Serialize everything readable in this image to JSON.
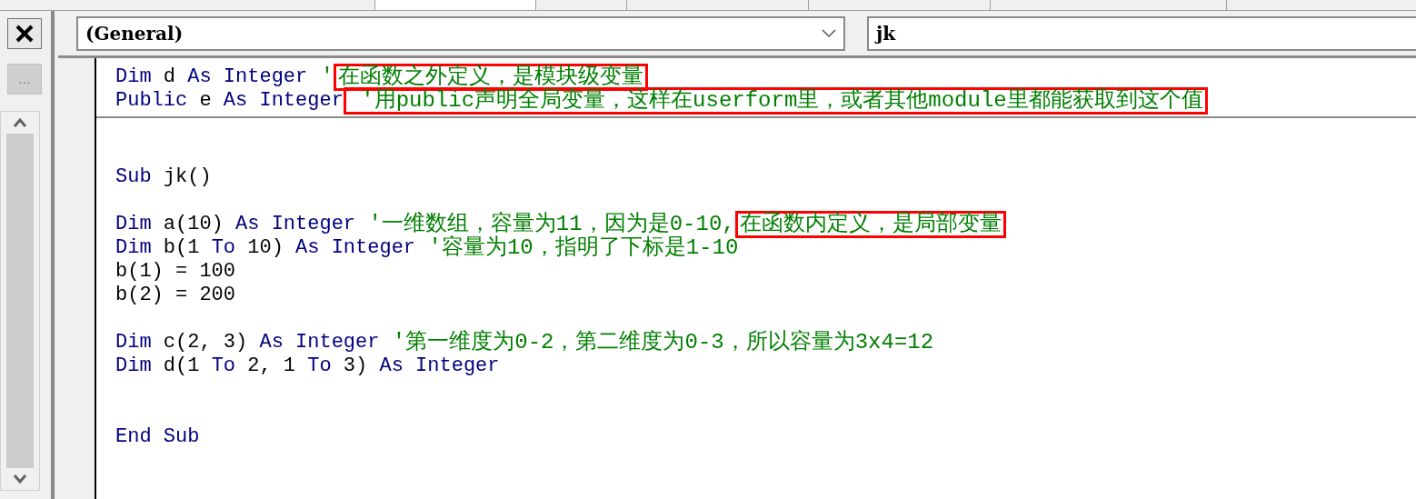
{
  "side_panel": {
    "ellipsis_button": {
      "label": "...",
      "disabled": true
    }
  },
  "object_box": {
    "value": "(General)"
  },
  "procedure_box": {
    "value": "jk"
  },
  "declarations": [
    {
      "kind": "code",
      "tokens": [
        {
          "kind": "keyword",
          "text": "Dim"
        },
        {
          "kind": "plain",
          "text": " d "
        },
        {
          "kind": "keyword",
          "text": "As Integer"
        },
        {
          "kind": "comment",
          "text": " '"
        },
        {
          "kind": "comment",
          "text": "在函数之外定义，是模块级变量",
          "boxed": true
        }
      ]
    },
    {
      "kind": "code",
      "tokens": [
        {
          "kind": "keyword",
          "text": "Public"
        },
        {
          "kind": "plain",
          "text": " e "
        },
        {
          "kind": "keyword",
          "text": "As Integer"
        },
        {
          "kind": "comment",
          "text": " '用public声明全局变量，这样在userform里，或者其他module里都能获取到这个值",
          "boxed": true
        }
      ]
    }
  ],
  "procedure": [
    {
      "kind": "blank"
    },
    {
      "kind": "blank"
    },
    {
      "kind": "code",
      "tokens": [
        {
          "kind": "keyword",
          "text": "Sub"
        },
        {
          "kind": "plain",
          "text": " jk()"
        }
      ]
    },
    {
      "kind": "blank"
    },
    {
      "kind": "code",
      "tokens": [
        {
          "kind": "keyword",
          "text": "Dim"
        },
        {
          "kind": "plain",
          "text": " a(10) "
        },
        {
          "kind": "keyword",
          "text": "As Integer"
        },
        {
          "kind": "comment",
          "text": " '一维数组，容量为11，因为是0-10,"
        },
        {
          "kind": "comment",
          "text": "在函数内定义，是局部变量",
          "boxed": true
        }
      ]
    },
    {
      "kind": "code",
      "tokens": [
        {
          "kind": "keyword",
          "text": "Dim"
        },
        {
          "kind": "plain",
          "text": " b(1 "
        },
        {
          "kind": "keyword",
          "text": "To"
        },
        {
          "kind": "plain",
          "text": " 10) "
        },
        {
          "kind": "keyword",
          "text": "As Integer"
        },
        {
          "kind": "comment",
          "text": " '容量为10，指明了下标是1-10"
        }
      ]
    },
    {
      "kind": "code",
      "tokens": [
        {
          "kind": "plain",
          "text": "b(1) = 100"
        }
      ]
    },
    {
      "kind": "code",
      "tokens": [
        {
          "kind": "plain",
          "text": "b(2) = 200"
        }
      ]
    },
    {
      "kind": "blank"
    },
    {
      "kind": "code",
      "tokens": [
        {
          "kind": "keyword",
          "text": "Dim"
        },
        {
          "kind": "plain",
          "text": " c(2, 3) "
        },
        {
          "kind": "keyword",
          "text": "As Integer"
        },
        {
          "kind": "comment",
          "text": " '第一维度为0-2，第二维度为0-3，所以容量为3x4=12"
        }
      ]
    },
    {
      "kind": "code",
      "tokens": [
        {
          "kind": "keyword",
          "text": "Dim"
        },
        {
          "kind": "plain",
          "text": " d(1 "
        },
        {
          "kind": "keyword",
          "text": "To"
        },
        {
          "kind": "plain",
          "text": " 2, 1 "
        },
        {
          "kind": "keyword",
          "text": "To"
        },
        {
          "kind": "plain",
          "text": " 3) "
        },
        {
          "kind": "keyword",
          "text": "As Integer"
        }
      ]
    },
    {
      "kind": "blank"
    },
    {
      "kind": "blank"
    },
    {
      "kind": "code",
      "tokens": [
        {
          "kind": "keyword",
          "text": "End Sub"
        }
      ]
    }
  ]
}
